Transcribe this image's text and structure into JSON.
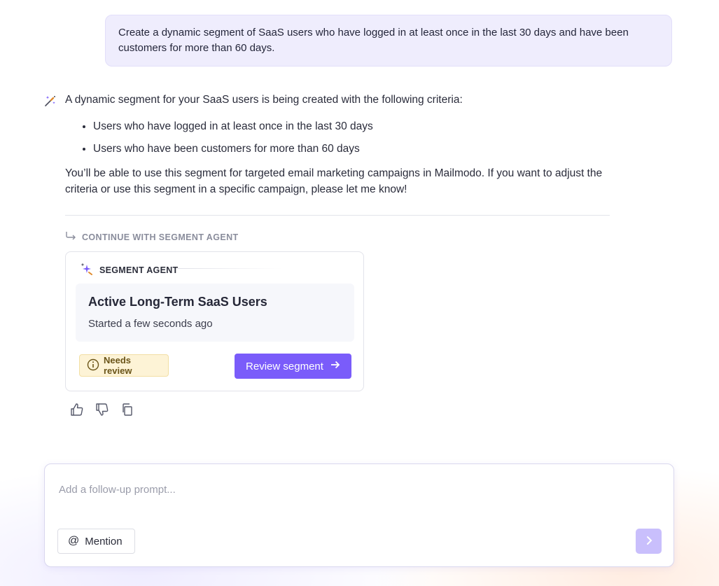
{
  "user_message": {
    "text": "Create a dynamic segment of SaaS users who have logged in at least once in the last 30 days and have been customers for more than 60 days."
  },
  "ai_message": {
    "intro": "A dynamic segment for your SaaS users is being created with the following criteria:",
    "criteria": [
      "Users who have logged in at least once in the last 30 days",
      "Users who have been customers for more than 60 days"
    ],
    "outro": "You’ll be able to use this segment for targeted email marketing campaigns in Mailmodo. If you want to adjust the criteria or use this segment in a specific campaign, please let me know!"
  },
  "continue_label": "CONTINUE WITH SEGMENT AGENT",
  "agent_card": {
    "header": "SEGMENT AGENT",
    "segment_title": "Active Long-Term SaaS Users",
    "segment_status": "Started a few seconds ago",
    "badge": "Needs review",
    "action_label": "Review segment"
  },
  "composer": {
    "placeholder": "Add a follow-up prompt...",
    "mention_label": "Mention"
  },
  "icons": {
    "ai": "magic-wand-icon",
    "continue": "arrow-return-icon",
    "agent": "sparkle-icon",
    "badge": "info-circle-icon",
    "action": "arrow-right-icon",
    "like": "thumbs-up-icon",
    "dislike": "thumbs-down-icon",
    "copy": "copy-icon",
    "mention": "at-icon",
    "send": "chevron-right-icon"
  },
  "colors": {
    "accent": "#7a5cfa",
    "user_bubble": "#efedfd",
    "badge_bg": "#fdf3d6",
    "send_disabled": "#c9bffc"
  }
}
